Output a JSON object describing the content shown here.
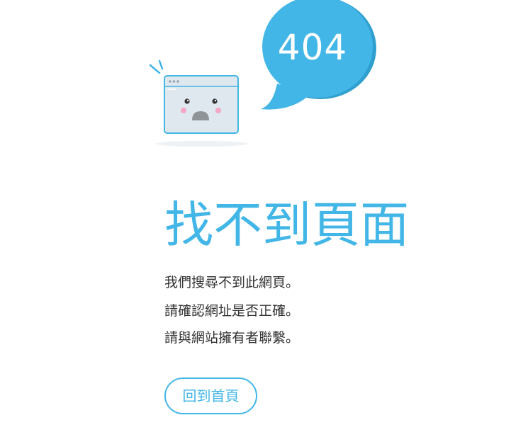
{
  "error": {
    "code": "404",
    "title": "找不到頁面"
  },
  "messages": [
    "我們搜尋不到此網頁。",
    "請確認網址是否正確。",
    "請與網站擁有者聯繫。"
  ],
  "actions": {
    "home_label": "回到首頁"
  },
  "colors": {
    "accent": "#42b6e6",
    "bubble": "#42b6e6",
    "bubble_shadow": "#2f9fcf",
    "window_fill": "#dfe8ef",
    "text": "#333333"
  }
}
